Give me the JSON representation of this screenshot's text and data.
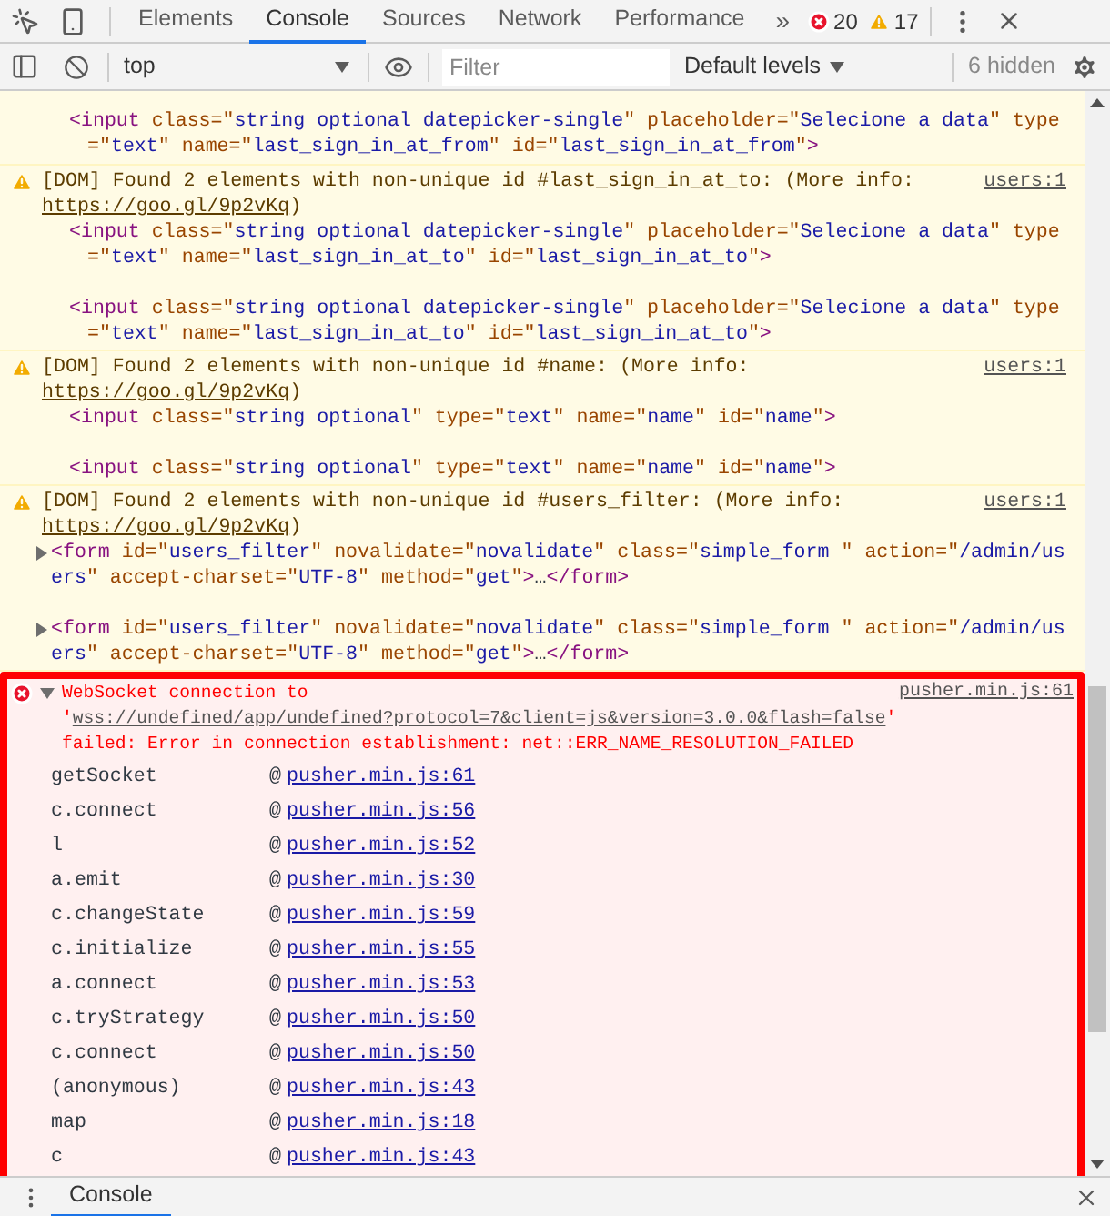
{
  "tabs": [
    {
      "label": "Elements",
      "selected": false
    },
    {
      "label": "Console",
      "selected": true
    },
    {
      "label": "Sources",
      "selected": false
    },
    {
      "label": "Network",
      "selected": false
    },
    {
      "label": "Performance",
      "selected": false
    }
  ],
  "more_tabs": "»",
  "error_count": "20",
  "warning_count": "17",
  "toolbar": {
    "context": "top",
    "filter": {
      "placeholder": "Filter"
    },
    "levels": "Default levels",
    "hidden": "6 hidden"
  },
  "entries": [
    {
      "kind": "continuation",
      "elements": [
        {
          "kind": "inline",
          "open": "<input",
          "end": ">",
          "attrs": [
            {
              "name": "class",
              "eq": "=\"",
              "value": "string optional datepicker-single",
              "close": "\""
            },
            {
              "name": "placeholder",
              "eq": "=\"",
              "value": "Selecione a data",
              "close": "\""
            },
            {
              "name": "type",
              "eq": "=\"",
              "value": "text",
              "close": "\""
            },
            {
              "name": "name",
              "eq": "=\"",
              "value": "last_sign_in_at_from",
              "close": "\""
            },
            {
              "name": "id",
              "eq": "=\"",
              "value": "last_sign_in_at_from",
              "close": "\""
            }
          ]
        }
      ]
    },
    {
      "kind": "warning",
      "message": "[DOM] Found 2 elements with non-unique id #last_sign_in_at_to: (More info: ",
      "link": "https://goo.gl/9p2vKq",
      "suffix": ")",
      "source": "users:1",
      "elements": [
        {
          "kind": "inline",
          "open": "<input",
          "end": ">",
          "attrs": [
            {
              "name": "class",
              "eq": "=\"",
              "value": "string optional datepicker-single",
              "close": "\""
            },
            {
              "name": "placeholder",
              "eq": "=\"",
              "value": "Selecione a data",
              "close": "\""
            },
            {
              "name": "type",
              "eq": "=\"",
              "value": "text",
              "close": "\""
            },
            {
              "name": "name",
              "eq": "=\"",
              "value": "last_sign_in_at_to",
              "close": "\""
            },
            {
              "name": "id",
              "eq": "=\"",
              "value": "last_sign_in_at_to",
              "close": "\""
            }
          ]
        },
        {
          "kind": "inline",
          "open": "<input",
          "end": ">",
          "attrs": [
            {
              "name": "class",
              "eq": "=\"",
              "value": "string optional datepicker-single",
              "close": "\""
            },
            {
              "name": "placeholder",
              "eq": "=\"",
              "value": "Selecione a data",
              "close": "\""
            },
            {
              "name": "type",
              "eq": "=\"",
              "value": "text",
              "close": "\""
            },
            {
              "name": "name",
              "eq": "=\"",
              "value": "last_sign_in_at_to",
              "close": "\""
            },
            {
              "name": "id",
              "eq": "=\"",
              "value": "last_sign_in_at_to",
              "close": "\""
            }
          ]
        }
      ]
    },
    {
      "kind": "warning",
      "message": "[DOM] Found 2 elements with non-unique id #name: (More info: ",
      "link": "https://goo.gl/9p2vKq",
      "suffix": ")",
      "source": "users:1",
      "elements": [
        {
          "kind": "inline",
          "open": "<input",
          "end": ">",
          "attrs": [
            {
              "name": "class",
              "eq": "=\"",
              "value": "string optional",
              "close": "\""
            },
            {
              "name": "type",
              "eq": "=\"",
              "value": "text",
              "close": "\""
            },
            {
              "name": "name",
              "eq": "=\"",
              "value": "name",
              "close": "\""
            },
            {
              "name": "id",
              "eq": "=\"",
              "value": "name",
              "close": "\""
            }
          ]
        },
        {
          "kind": "inline",
          "open": "<input",
          "end": ">",
          "attrs": [
            {
              "name": "class",
              "eq": "=\"",
              "value": "string optional",
              "close": "\""
            },
            {
              "name": "type",
              "eq": "=\"",
              "value": "text",
              "close": "\""
            },
            {
              "name": "name",
              "eq": "=\"",
              "value": "name",
              "close": "\""
            },
            {
              "name": "id",
              "eq": "=\"",
              "value": "name",
              "close": "\""
            }
          ]
        }
      ]
    },
    {
      "kind": "warning",
      "message": "[DOM] Found 2 elements with non-unique id #users_filter: (More info: ",
      "link": "https://goo.gl/9p2vKq",
      "suffix": ")",
      "source": "users:1",
      "elements": [
        {
          "kind": "collapsible",
          "expanded": false,
          "open": "<form",
          "end": ">",
          "ellipsis": "…",
          "closing": "</form>",
          "attrs": [
            {
              "name": "id",
              "eq": "=\"",
              "value": "users_filter",
              "close": "\""
            },
            {
              "name": "novalidate",
              "eq": "=\"",
              "value": "novalidate",
              "close": "\""
            },
            {
              "name": "class",
              "eq": "=\"",
              "value": "simple_form ",
              "close": "\""
            },
            {
              "name": "action",
              "eq": "=\"",
              "value": "/admin/users",
              "close": "\""
            },
            {
              "name": "accept-charset",
              "eq": "=\"",
              "value": "UTF-8",
              "close": "\""
            },
            {
              "name": "method",
              "eq": "=\"",
              "value": "get",
              "close": "\""
            }
          ]
        },
        {
          "kind": "collapsible",
          "expanded": false,
          "open": "<form",
          "end": ">",
          "ellipsis": "…",
          "closing": "</form>",
          "attrs": [
            {
              "name": "id",
              "eq": "=\"",
              "value": "users_filter",
              "close": "\""
            },
            {
              "name": "novalidate",
              "eq": "=\"",
              "value": "novalidate",
              "close": "\""
            },
            {
              "name": "class",
              "eq": "=\"",
              "value": "simple_form ",
              "close": "\""
            },
            {
              "name": "action",
              "eq": "=\"",
              "value": "/admin/users",
              "close": "\""
            },
            {
              "name": "accept-charset",
              "eq": "=\"",
              "value": "UTF-8",
              "close": "\""
            },
            {
              "name": "method",
              "eq": "=\"",
              "value": "get",
              "close": "\""
            }
          ]
        }
      ]
    },
    {
      "kind": "error",
      "highlighted": true,
      "expanded": true,
      "message": "WebSocket connection to '",
      "link": "wss://undefined/app/undefined?protocol=7&client=js&version=3.0.0&flash=false",
      "suffix": "' failed: Error in connection establishment: net::ERR_NAME_RESOLUTION_FAILED",
      "source": "pusher.min.js:61",
      "stack": [
        {
          "function": "getSocket",
          "at": "@",
          "location": "pusher.min.js:61"
        },
        {
          "function": "c.connect",
          "at": "@",
          "location": "pusher.min.js:56"
        },
        {
          "function": "l",
          "at": "@",
          "location": "pusher.min.js:52"
        },
        {
          "function": "a.emit",
          "at": "@",
          "location": "pusher.min.js:30"
        },
        {
          "function": "c.changeState",
          "at": "@",
          "location": "pusher.min.js:59"
        },
        {
          "function": "c.initialize",
          "at": "@",
          "location": "pusher.min.js:55"
        },
        {
          "function": "a.connect",
          "at": "@",
          "location": "pusher.min.js:53"
        },
        {
          "function": "c.tryStrategy",
          "at": "@",
          "location": "pusher.min.js:50"
        },
        {
          "function": "c.connect",
          "at": "@",
          "location": "pusher.min.js:50"
        },
        {
          "function": "(anonymous)",
          "at": "@",
          "location": "pusher.min.js:43"
        },
        {
          "function": "map",
          "at": "@",
          "location": "pusher.min.js:18"
        },
        {
          "function": "c",
          "at": "@",
          "location": "pusher.min.js:43"
        }
      ]
    }
  ],
  "drawer": {
    "tabs": [
      {
        "label": "Console",
        "selected": true
      }
    ]
  }
}
